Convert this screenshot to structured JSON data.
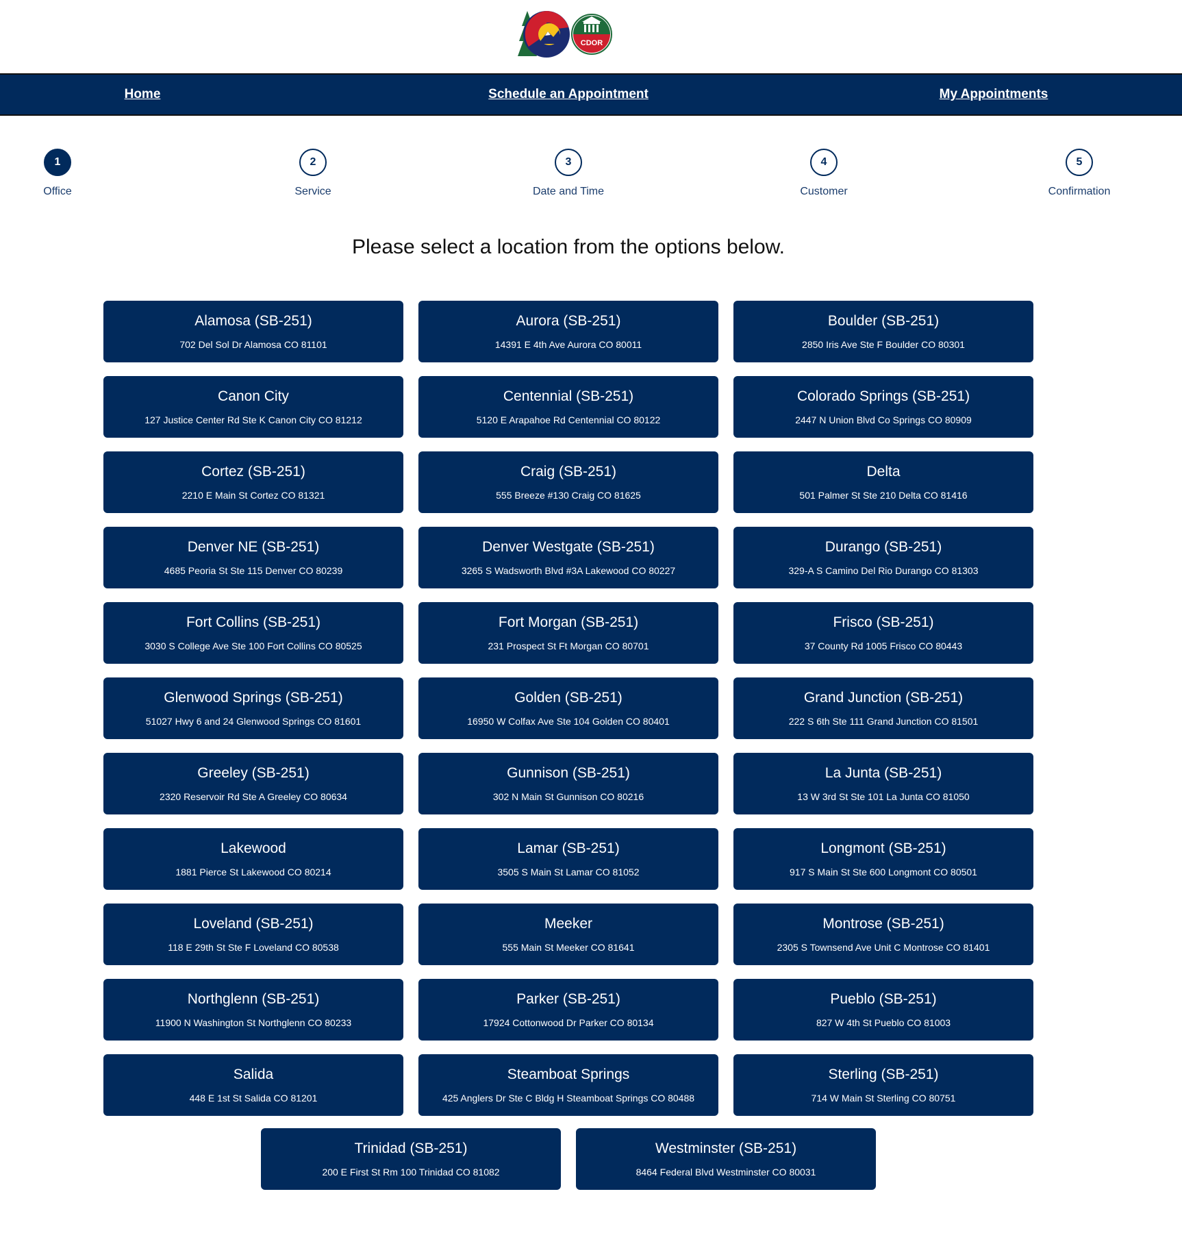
{
  "header": {
    "logo_text": "CDOR"
  },
  "nav": {
    "home": "Home",
    "schedule": "Schedule an Appointment",
    "my_appointments": "My Appointments"
  },
  "steps": [
    {
      "number": "1",
      "label": "Office"
    },
    {
      "number": "2",
      "label": "Service"
    },
    {
      "number": "3",
      "label": "Date and Time"
    },
    {
      "number": "4",
      "label": "Customer"
    },
    {
      "number": "5",
      "label": "Confirmation"
    }
  ],
  "instruction": "Please select a location from the options below.",
  "offices": [
    {
      "name": "Alamosa (SB-251)",
      "address": "702 Del Sol Dr Alamosa CO 81101"
    },
    {
      "name": "Aurora (SB-251)",
      "address": "14391 E 4th Ave Aurora CO 80011"
    },
    {
      "name": "Boulder (SB-251)",
      "address": "2850 Iris Ave Ste F Boulder CO 80301"
    },
    {
      "name": "Canon City",
      "address": "127 Justice Center Rd Ste K Canon City CO 81212"
    },
    {
      "name": "Centennial (SB-251)",
      "address": "5120 E Arapahoe Rd Centennial CO 80122"
    },
    {
      "name": "Colorado Springs (SB-251)",
      "address": "2447 N Union Blvd Co Springs CO 80909"
    },
    {
      "name": "Cortez (SB-251)",
      "address": "2210 E Main St Cortez CO 81321"
    },
    {
      "name": "Craig (SB-251)",
      "address": "555 Breeze #130 Craig CO 81625"
    },
    {
      "name": "Delta",
      "address": "501 Palmer St Ste 210 Delta CO 81416"
    },
    {
      "name": "Denver NE (SB-251)",
      "address": "4685 Peoria St Ste 115 Denver CO 80239"
    },
    {
      "name": "Denver Westgate (SB-251)",
      "address": "3265 S Wadsworth Blvd #3A Lakewood CO 80227"
    },
    {
      "name": "Durango (SB-251)",
      "address": "329-A S Camino Del Rio Durango CO 81303"
    },
    {
      "name": "Fort Collins (SB-251)",
      "address": "3030 S College Ave Ste 100 Fort Collins CO 80525"
    },
    {
      "name": "Fort Morgan (SB-251)",
      "address": "231 Prospect St Ft Morgan CO 80701"
    },
    {
      "name": "Frisco (SB-251)",
      "address": "37 County Rd 1005 Frisco CO 80443"
    },
    {
      "name": "Glenwood Springs (SB-251)",
      "address": "51027 Hwy 6 and 24 Glenwood Springs CO 81601"
    },
    {
      "name": "Golden (SB-251)",
      "address": "16950 W Colfax Ave Ste 104 Golden CO 80401"
    },
    {
      "name": "Grand Junction (SB-251)",
      "address": "222 S 6th Ste 111 Grand Junction CO 81501"
    },
    {
      "name": "Greeley (SB-251)",
      "address": "2320 Reservoir Rd Ste A Greeley CO 80634"
    },
    {
      "name": "Gunnison (SB-251)",
      "address": "302 N Main St Gunnison CO 80216"
    },
    {
      "name": "La Junta (SB-251)",
      "address": "13 W 3rd St Ste 101 La Junta CO 81050"
    },
    {
      "name": "Lakewood",
      "address": "1881 Pierce St Lakewood CO 80214"
    },
    {
      "name": "Lamar (SB-251)",
      "address": "3505 S Main St Lamar CO 81052"
    },
    {
      "name": "Longmont (SB-251)",
      "address": "917 S Main St Ste 600 Longmont CO 80501"
    },
    {
      "name": "Loveland (SB-251)",
      "address": "118 E 29th St Ste F Loveland CO 80538"
    },
    {
      "name": "Meeker",
      "address": "555 Main St Meeker CO 81641"
    },
    {
      "name": "Montrose (SB-251)",
      "address": "2305 S Townsend Ave Unit C Montrose CO 81401"
    },
    {
      "name": "Northglenn (SB-251)",
      "address": "11900 N Washington St Northglenn CO 80233"
    },
    {
      "name": "Parker (SB-251)",
      "address": "17924 Cottonwood Dr Parker CO 80134"
    },
    {
      "name": "Pueblo (SB-251)",
      "address": "827 W 4th St Pueblo CO 81003"
    },
    {
      "name": "Salida",
      "address": "448 E 1st St Salida CO 81201"
    },
    {
      "name": "Steamboat Springs",
      "address": "425 Anglers Dr Ste C Bldg H Steamboat Springs CO 80488"
    },
    {
      "name": "Sterling (SB-251)",
      "address": "714 W Main St Sterling CO 80751"
    },
    {
      "name": "Trinidad (SB-251)",
      "address": "200 E First St Rm 100 Trinidad CO 81082"
    },
    {
      "name": "Westminster (SB-251)",
      "address": "8464 Federal Blvd Westminster CO 80031"
    }
  ]
}
